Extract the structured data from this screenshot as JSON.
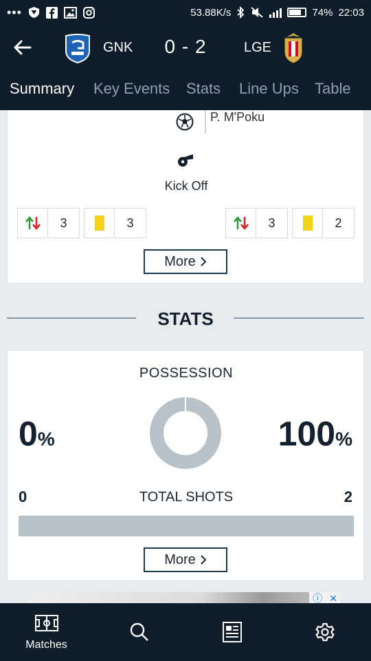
{
  "status_bar": {
    "speed": "53.88K/s",
    "battery": "74%",
    "time": "22:03",
    "icons": [
      "more-dots-icon",
      "shield-icon",
      "facebook-icon",
      "image-icon",
      "instagram-icon",
      "bluetooth-icon",
      "mute-icon",
      "signal-icon",
      "battery-icon"
    ]
  },
  "match": {
    "home_team": "GNK",
    "away_team": "LGE",
    "score": "0 - 2",
    "home_crest": "genk-crest-icon",
    "away_crest": "standard-liege-crest-icon"
  },
  "tabs": [
    {
      "label": "Summary",
      "active": true
    },
    {
      "label": "Key Events",
      "active": false
    },
    {
      "label": "Stats",
      "active": false
    },
    {
      "label": "Line Ups",
      "active": false
    },
    {
      "label": "Table",
      "active": false
    }
  ],
  "events": {
    "last_event_player": "P. M'Poku",
    "kickoff_label": "Kick Off",
    "home_substitutions": "3",
    "home_yellow_cards": "3",
    "away_substitutions": "3",
    "away_yellow_cards": "2",
    "more_label": "More"
  },
  "stats": {
    "section_title": "STATS",
    "possession_title": "POSSESSION",
    "home_possession": "0",
    "away_possession": "100",
    "percent_sign": "%",
    "possession_home_fraction": 0.0,
    "total_shots_title": "TOTAL SHOTS",
    "home_shots": "0",
    "away_shots": "2",
    "more_label": "More"
  },
  "bottom_nav": {
    "items": [
      {
        "name": "matches",
        "label": "Matches",
        "icon": "pitch-icon"
      },
      {
        "name": "search",
        "label": "",
        "icon": "search-icon"
      },
      {
        "name": "news",
        "label": "",
        "icon": "news-icon"
      },
      {
        "name": "settings",
        "label": "",
        "icon": "gear-icon"
      }
    ]
  },
  "colors": {
    "header_bg": "#0f1d2b",
    "tab_active": "#ffffff",
    "tab_inactive": "#8fa0b3",
    "yellow_card": "#f7d21a",
    "sub_in": "#2e9b3c",
    "sub_out": "#d6262d",
    "possession_away": "#b7c2cb"
  }
}
